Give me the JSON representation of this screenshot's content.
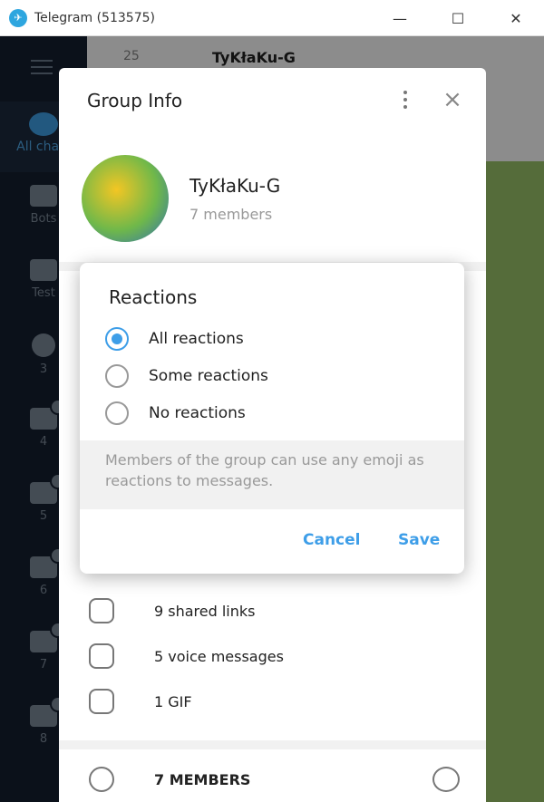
{
  "window": {
    "title": "Telegram (513575)",
    "minimize": "—",
    "maximize": "☐",
    "close": "✕"
  },
  "sidebar": {
    "allchats_label": "All chats",
    "folders": [
      {
        "label": "Bots"
      },
      {
        "label": "Test"
      },
      {
        "label": "3"
      },
      {
        "label": "4"
      },
      {
        "label": "5"
      },
      {
        "label": "6"
      },
      {
        "label": "7"
      },
      {
        "label": "8"
      }
    ]
  },
  "chat": {
    "title": "TyKłaKu-G",
    "unread": "25"
  },
  "group_info": {
    "title": "Group Info",
    "name": "TyKłaKu-G",
    "members": "7 members",
    "close_glyph": "×",
    "rows": [
      {
        "label": "9 shared links"
      },
      {
        "label": "5 voice messages"
      },
      {
        "label": "1 GIF"
      }
    ],
    "members_section": "7 MEMBERS"
  },
  "dialog": {
    "title": "Reactions",
    "options": [
      {
        "label": "All reactions",
        "checked": true
      },
      {
        "label": "Some reactions",
        "checked": false
      },
      {
        "label": "No reactions",
        "checked": false
      }
    ],
    "description": "Members of the group can use any emoji as reactions to messages.",
    "cancel": "Cancel",
    "save": "Save"
  },
  "colors": {
    "accent": "#3e9ee8",
    "sidebar": "#152031"
  }
}
